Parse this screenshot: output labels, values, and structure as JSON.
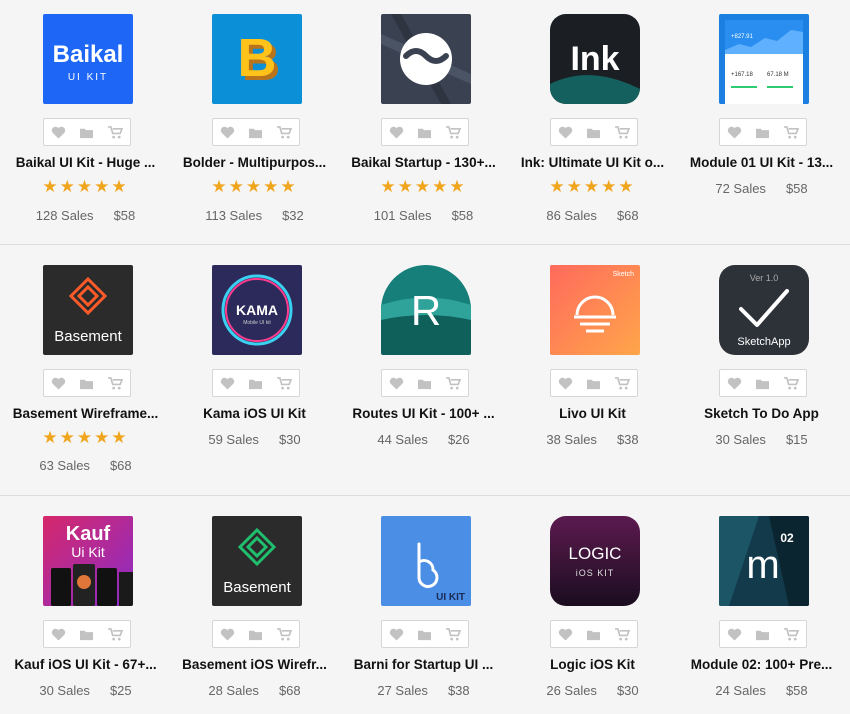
{
  "rows": [
    [
      {
        "title": "Baikal UI Kit - Huge ...",
        "stars": "★★★★★",
        "sales": "128 Sales",
        "price": "$58",
        "icon": "baikal-ui-kit-icon"
      },
      {
        "title": "Bolder - Multipurpos...",
        "stars": "★★★★★",
        "sales": "113 Sales",
        "price": "$32",
        "icon": "bolder-b-icon"
      },
      {
        "title": "Baikal Startup - 130+...",
        "stars": "★★★★★",
        "sales": "101 Sales",
        "price": "$58",
        "icon": "baikal-startup-icon"
      },
      {
        "title": "Ink: Ultimate UI Kit o...",
        "stars": "★★★★★",
        "sales": "86 Sales",
        "price": "$68",
        "icon": "ink-icon"
      },
      {
        "title": "Module 01 UI Kit - 13...",
        "stars": "",
        "sales": "72 Sales",
        "price": "$58",
        "icon": "module-01-dashboard-icon"
      }
    ],
    [
      {
        "title": "Basement Wireframe...",
        "stars": "★★★★★",
        "sales": "63 Sales",
        "price": "$68",
        "icon": "basement-wireframe-icon"
      },
      {
        "title": "Kama iOS UI Kit",
        "stars": "",
        "sales": "59 Sales",
        "price": "$30",
        "icon": "kama-ios-icon"
      },
      {
        "title": "Routes UI Kit - 100+ ...",
        "stars": "",
        "sales": "44 Sales",
        "price": "$26",
        "icon": "routes-r-icon"
      },
      {
        "title": "Livo UI Kit",
        "stars": "",
        "sales": "38 Sales",
        "price": "$38",
        "icon": "livo-sunset-icon"
      },
      {
        "title": "Sketch To Do App",
        "stars": "",
        "sales": "30 Sales",
        "price": "$15",
        "icon": "sketchapp-check-icon"
      }
    ],
    [
      {
        "title": "Kauf iOS UI Kit - 67+...",
        "stars": "",
        "sales": "30 Sales",
        "price": "$25",
        "icon": "kauf-ui-kit-icon"
      },
      {
        "title": "Basement iOS Wirefr...",
        "stars": "",
        "sales": "28 Sales",
        "price": "$68",
        "icon": "basement-ios-icon"
      },
      {
        "title": "Barni for Startup UI ...",
        "stars": "",
        "sales": "27 Sales",
        "price": "$38",
        "icon": "barni-icon"
      },
      {
        "title": "Logic iOS Kit",
        "stars": "",
        "sales": "26 Sales",
        "price": "$30",
        "icon": "logic-ios-icon"
      },
      {
        "title": "Module 02: 100+ Pre...",
        "stars": "",
        "sales": "24 Sales",
        "price": "$58",
        "icon": "module-02-icon"
      }
    ]
  ],
  "thumb_text": {
    "baikal_line1": "Baikal",
    "baikal_line2": "UI KIT",
    "bolder": "B",
    "ink": "Ink",
    "module01_price": "+827.91",
    "module01_a": "+167.18",
    "module01_b": "67.18 M",
    "basement": "Basement",
    "kama": "KAMA",
    "kama_sub": "Mobile UI kit",
    "routes": "R",
    "livo_tag": "Sketch",
    "sketch_ver": "Ver 1.0",
    "sketch_name": "SketchApp",
    "kauf_line1": "Kauf",
    "kauf_line2": "Ui Kit",
    "basement2": "Basement",
    "barni_tag": "UI KIT",
    "logic": "LOGIC",
    "logic_sub": "iOS KIT",
    "module02_m": "m",
    "module02_num": "02"
  },
  "colors": {
    "star": "#f0a51e",
    "baikal_blue": "#1e66f5",
    "bolder_blue": "#0b8fd6",
    "ink_dark": "#1b1f24",
    "kama_bg": "#2c2a5a",
    "routes_teal": "#167f7a",
    "livo_orange": "#ff7e54",
    "barni_blue": "#4a8ee6"
  }
}
